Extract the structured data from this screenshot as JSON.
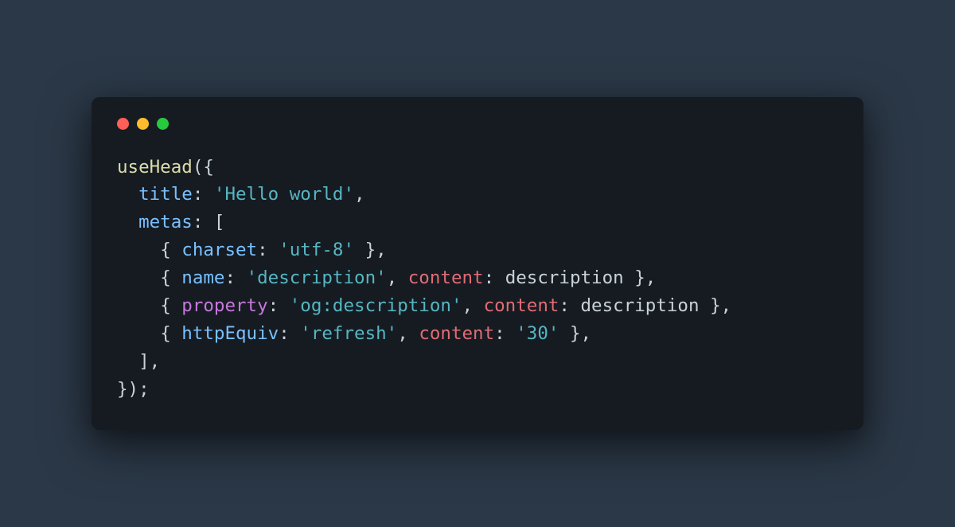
{
  "code": {
    "functionName": "useHead",
    "titleKey": "title",
    "titleValue": "'Hello world'",
    "metasKey": "metas",
    "metas": [
      {
        "charsetKey": "charset",
        "charsetVal": "'utf-8'"
      },
      {
        "nameKey": "name",
        "nameVal": "'description'",
        "contentKey": "content",
        "contentVal": "description"
      },
      {
        "propertyKey": "property",
        "propertyVal": "'og:description'",
        "contentKey": "content",
        "contentVal": "description"
      },
      {
        "httpEquivKey": "httpEquiv",
        "httpEquivVal": "'refresh'",
        "contentKey": "content",
        "contentVal": "'30'"
      }
    ]
  }
}
